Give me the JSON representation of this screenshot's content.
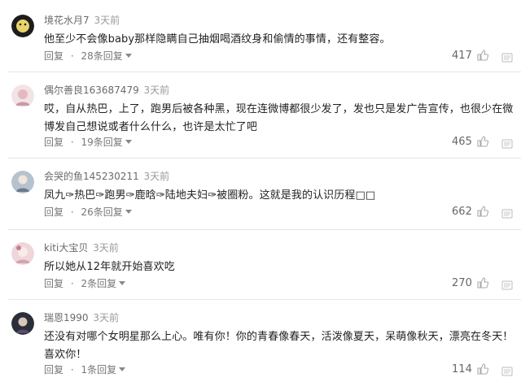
{
  "comments": [
    {
      "username": "境花水月7",
      "time": "3天前",
      "text": "他至少不会像baby那样隐瞒自己抽烟喝酒纹身和偷情的事情，还有整容。",
      "reply_label": "回复",
      "replies_label": "28条回复",
      "likes": "417",
      "avatar_color": "#1d1d1d"
    },
    {
      "username": "偶尔善良163687479",
      "time": "3天前",
      "text": "哎，自从热巴，上了，跑男后被各种黑，现在连微博都很少发了，发也只是发广告宣传，也很少在微博发自己想说或者什么什么，也许是太忙了吧",
      "reply_label": "回复",
      "replies_label": "19条回复",
      "likes": "465",
      "avatar_color": "#e8c9c9"
    },
    {
      "username": "会哭的鱼145230211",
      "time": "3天前",
      "text": "凤九✑热巴✑跑男✑鹿晗✑陆地夫妇✑被圈粉。这就是我的认识历程□□",
      "reply_label": "回复",
      "replies_label": "26条回复",
      "likes": "662",
      "avatar_color": "#9aa8b8"
    },
    {
      "username": "kiti大宝贝",
      "time": "3天前",
      "text": "所以她从12年就开始喜欢吃",
      "reply_label": "回复",
      "replies_label": "2条回复",
      "likes": "270",
      "avatar_color": "#d9b0b8"
    },
    {
      "username": "瑞恩1990",
      "time": "3天前",
      "text": "还没有对哪个女明星那么上心。唯有你！你的青春像春天，活泼像夏天，呆萌像秋天，漂亮在冬天！喜欢你！",
      "reply_label": "回复",
      "replies_label": "1条回复",
      "likes": "114",
      "avatar_color": "#2a2f3a"
    }
  ]
}
